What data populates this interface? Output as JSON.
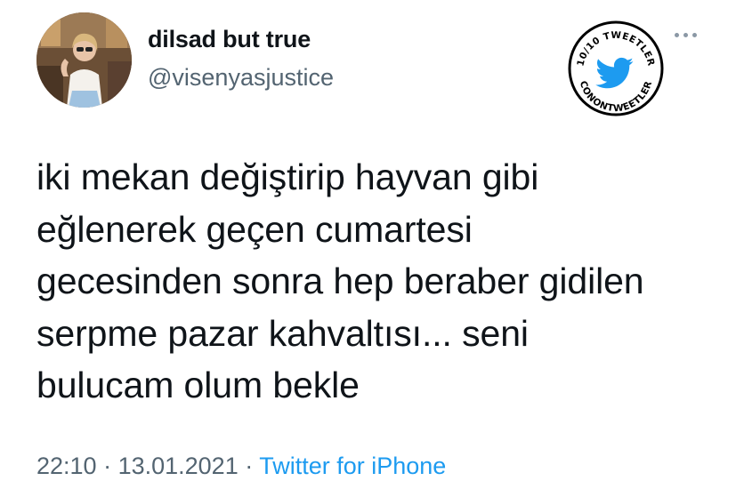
{
  "author": {
    "display_name": "dilsad but true",
    "handle": "@visenyasjustice"
  },
  "badge": {
    "top_text": "10/10 TWEETLER",
    "bottom_text": "CONONTWEETLER",
    "icon": "twitter-bird-icon",
    "accent": "#1d9bf0"
  },
  "tweet": {
    "text": "iki mekan değiştirip hayvan gibi\neğlenerek geçen cumartesi\ngecesinden sonra hep beraber gidilen\nserpme pazar kahvaltısı... seni\nbulucam olum bekle"
  },
  "meta": {
    "time": "22:10",
    "separator_1": " · ",
    "date": "13.01.2021",
    "separator_2": " · ",
    "source": "Twitter for iPhone"
  },
  "colors": {
    "text": "#0f1419",
    "secondary": "#536471",
    "link": "#1d9bf0"
  }
}
